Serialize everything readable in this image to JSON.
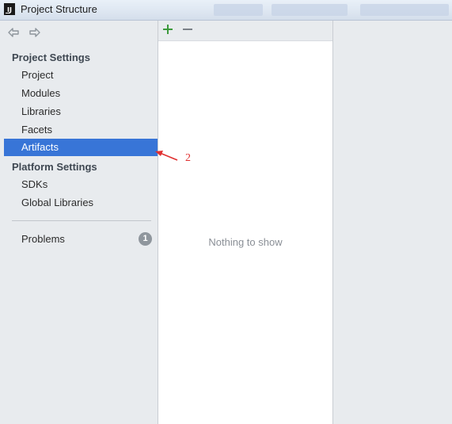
{
  "window": {
    "title": "Project Structure",
    "app_icon_text": "IJ"
  },
  "nav": {
    "back_icon": "arrow-left-icon",
    "forward_icon": "arrow-right-icon"
  },
  "sidebar": {
    "project_settings_heading": "Project Settings",
    "project_items": [
      {
        "label": "Project",
        "selected": false
      },
      {
        "label": "Modules",
        "selected": false
      },
      {
        "label": "Libraries",
        "selected": false
      },
      {
        "label": "Facets",
        "selected": false
      },
      {
        "label": "Artifacts",
        "selected": true
      }
    ],
    "platform_settings_heading": "Platform Settings",
    "platform_items": [
      {
        "label": "SDKs"
      },
      {
        "label": "Global Libraries"
      }
    ],
    "problems": {
      "label": "Problems",
      "count": "1"
    }
  },
  "toolbar": {
    "add_icon": "plus-icon",
    "remove_icon": "minus-icon"
  },
  "artifacts_list": {
    "empty_text": "Nothing to show"
  },
  "annotation": {
    "number": "2",
    "color": "#e03030"
  },
  "colors": {
    "selection": "#3875d7",
    "add_green": "#3c9a3c"
  }
}
